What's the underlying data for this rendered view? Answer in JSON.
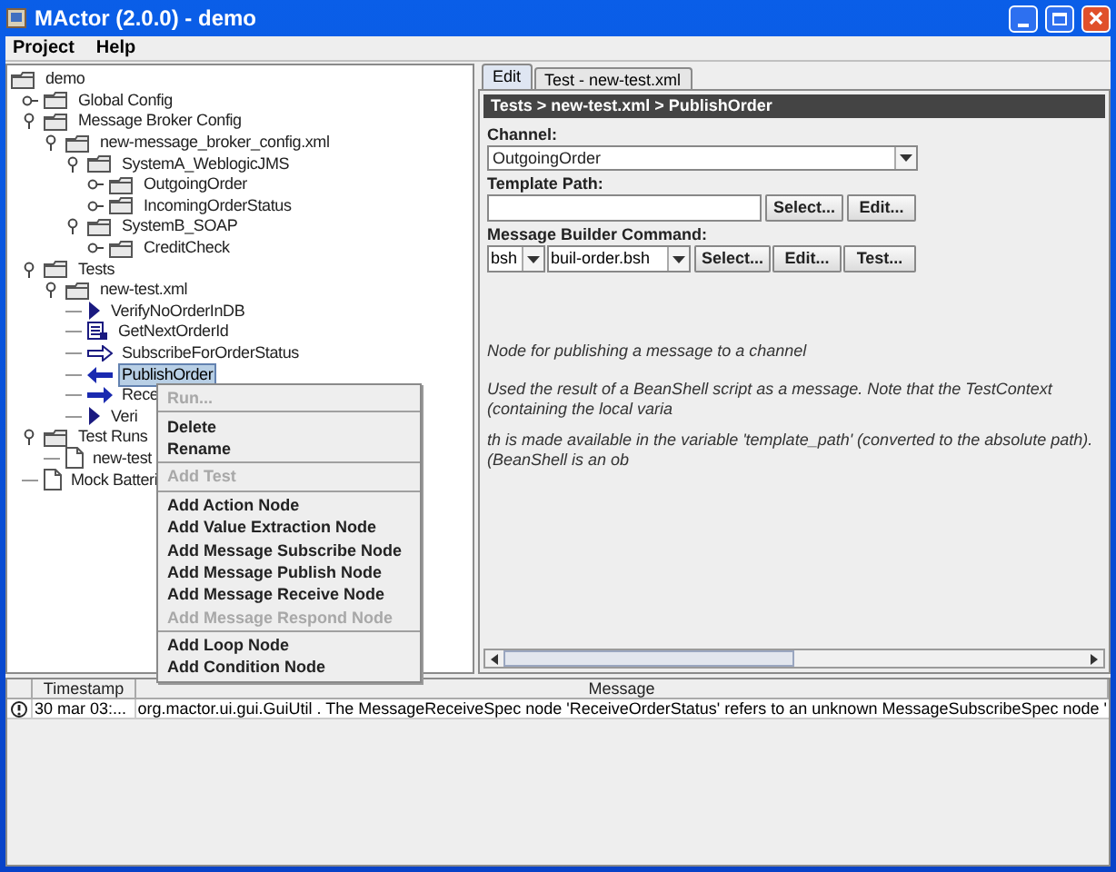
{
  "window": {
    "title": "MActor (2.0.0) - demo"
  },
  "menu_bar": [
    {
      "label": "Project"
    },
    {
      "label": "Help"
    }
  ],
  "tree": {
    "label": "demo",
    "kind": "folder",
    "selected": false,
    "children": [
      {
        "label": "Global Config",
        "kind": "folder",
        "expanded": false,
        "selected": false
      },
      {
        "label": "Message Broker Config",
        "kind": "folder",
        "expanded": true,
        "selected": false,
        "children": [
          {
            "label": "new-message_broker_config.xml",
            "kind": "folder",
            "expanded": true,
            "selected": false,
            "children": [
              {
                "label": "SystemA_WeblogicJMS",
                "kind": "folder",
                "expanded": true,
                "selected": false,
                "children": [
                  {
                    "label": "OutgoingOrder",
                    "kind": "folder",
                    "expanded": false,
                    "selected": false
                  },
                  {
                    "label": "IncomingOrderStatus",
                    "kind": "folder",
                    "expanded": false,
                    "selected": false
                  }
                ]
              },
              {
                "label": "SystemB_SOAP",
                "kind": "folder",
                "expanded": true,
                "selected": false,
                "children": [
                  {
                    "label": "CreditCheck",
                    "kind": "folder",
                    "expanded": false,
                    "selected": false
                  }
                ]
              }
            ]
          }
        ]
      },
      {
        "label": "Tests",
        "kind": "folder",
        "expanded": true,
        "selected": false,
        "children": [
          {
            "label": "new-test.xml",
            "kind": "folder",
            "expanded": true,
            "selected": false,
            "children": [
              {
                "label": "VerifyNoOrderInDB",
                "kind": "action",
                "selected": false
              },
              {
                "label": "GetNextOrderId",
                "kind": "value",
                "selected": false
              },
              {
                "label": "SubscribeForOrderStatus",
                "kind": "subscribe",
                "selected": false
              },
              {
                "label": "PublishOrder",
                "kind": "publish",
                "selected": true
              },
              {
                "label": "Rece",
                "kind": "receive",
                "selected": false
              },
              {
                "label": "Veri",
                "kind": "action",
                "selected": false
              }
            ]
          }
        ]
      },
      {
        "label": "Test Runs",
        "kind": "folder",
        "expanded": true,
        "selected": false,
        "children": [
          {
            "label": "new-test",
            "kind": "document",
            "selected": false
          }
        ]
      },
      {
        "label": "Mock Batteri",
        "kind": "document",
        "selected": false
      }
    ]
  },
  "context_menu": [
    {
      "kind": "item",
      "label": "Run...",
      "disabled": true
    },
    {
      "kind": "separator"
    },
    {
      "kind": "item",
      "label": "Delete",
      "disabled": false
    },
    {
      "kind": "item",
      "label": "Rename",
      "disabled": false
    },
    {
      "kind": "separator"
    },
    {
      "kind": "item",
      "label": "Add Test",
      "disabled": true
    },
    {
      "kind": "separator"
    },
    {
      "kind": "item",
      "label": "Add Action Node",
      "disabled": false
    },
    {
      "kind": "item",
      "label": "Add Value Extraction Node",
      "disabled": false
    },
    {
      "kind": "item",
      "label": "Add Message Subscribe Node",
      "disabled": false
    },
    {
      "kind": "item",
      "label": "Add Message Publish Node",
      "disabled": false
    },
    {
      "kind": "item",
      "label": "Add Message Receive Node",
      "disabled": false
    },
    {
      "kind": "item",
      "label": "Add Message Respond Node",
      "disabled": true
    },
    {
      "kind": "separator"
    },
    {
      "kind": "item",
      "label": "Add Loop Node",
      "disabled": false
    },
    {
      "kind": "item",
      "label": "Add Condition Node",
      "disabled": false
    }
  ],
  "editor": {
    "tabs": [
      {
        "label": "Edit",
        "selected": true
      },
      {
        "label": "Test - new-test.xml",
        "selected": false
      }
    ],
    "breadcrumb": "Tests > new-test.xml > PublishOrder",
    "channel": {
      "label": "Channel:",
      "value": "OutgoingOrder"
    },
    "template_path": {
      "label": "Template Path:",
      "buttons": [
        "Select...",
        "Edit..."
      ]
    },
    "message_builder": {
      "label": "Message Builder Command:",
      "language": "bsh",
      "script": "buil-order.bsh",
      "buttons": [
        "Select...",
        "Edit...",
        "Test..."
      ]
    },
    "description": [
      "Node for publishing a message to a channel",
      "Used the result of a BeanShell script as a message. Note that the TestContext (containing the local varia",
      "th is made available in the variable 'template_path' (converted to the absolute path). (BeanShell is an ob"
    ]
  },
  "log": {
    "columns": [
      {
        "label": "Timestamp"
      },
      {
        "label": "Message"
      }
    ],
    "rows": [
      {
        "kind": "warning",
        "timestamp": "30 mar 03:...",
        "message": "org.mactor.ui.gui.GuiUtil . The MessageReceiveSpec node 'ReceiveOrderStatus' refers to an unknown MessageSubscribeSpec node '"
      }
    ]
  }
}
